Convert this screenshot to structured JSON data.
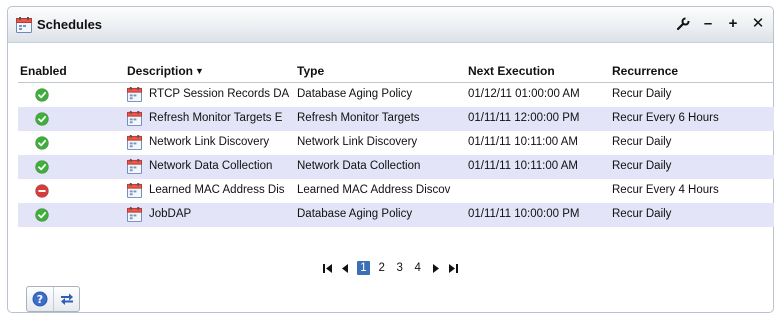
{
  "portlet": {
    "title": "Schedules",
    "title_icon": "calendar-icon",
    "tools": [
      "wrench-icon",
      "minimize-icon",
      "maximize-icon",
      "close-icon"
    ],
    "tool_glyphs": {
      "minimize": "–",
      "maximize": "+",
      "close": "✕"
    }
  },
  "table": {
    "columns": [
      "Enabled",
      "Description",
      "Type",
      "Next Execution",
      "Recurrence"
    ],
    "sorted_column": "Description",
    "sort_indicator": "▼",
    "rows": [
      {
        "enabled": true,
        "description": "RTCP Session Records DA",
        "type": "Database Aging Policy",
        "next_execution": "01/12/11 01:00:00 AM",
        "recurrence": "Recur Daily"
      },
      {
        "enabled": true,
        "description": "Refresh Monitor Targets E",
        "type": "Refresh Monitor Targets",
        "next_execution": "01/11/11 12:00:00 PM",
        "recurrence": "Recur Every 6 Hours"
      },
      {
        "enabled": true,
        "description": "Network Link Discovery",
        "type": "Network Link Discovery",
        "next_execution": "01/11/11 10:11:00 AM",
        "recurrence": "Recur Daily"
      },
      {
        "enabled": true,
        "description": "Network Data Collection",
        "type": "Network Data Collection",
        "next_execution": "01/11/11 10:11:00 AM",
        "recurrence": "Recur Daily"
      },
      {
        "enabled": false,
        "description": "Learned MAC Address Dis",
        "type": "Learned MAC Address Discov",
        "next_execution": "",
        "recurrence": "Recur Every 4 Hours"
      },
      {
        "enabled": true,
        "description": "JobDAP",
        "type": "Database Aging Policy",
        "next_execution": "01/11/11 10:00:00 PM",
        "recurrence": "Recur Daily"
      }
    ]
  },
  "pagination": {
    "pages": [
      "1",
      "2",
      "3",
      "4"
    ],
    "current_page": "1"
  },
  "footer_buttons": [
    "help-icon",
    "refresh-arrows-icon"
  ],
  "colors": {
    "enabled_green": "#3fae3a",
    "disabled_red": "#d83b3b",
    "alt_row": "#e3e4f7",
    "active_page": "#3d6fb6",
    "help_blue": "#2f5fb3"
  }
}
